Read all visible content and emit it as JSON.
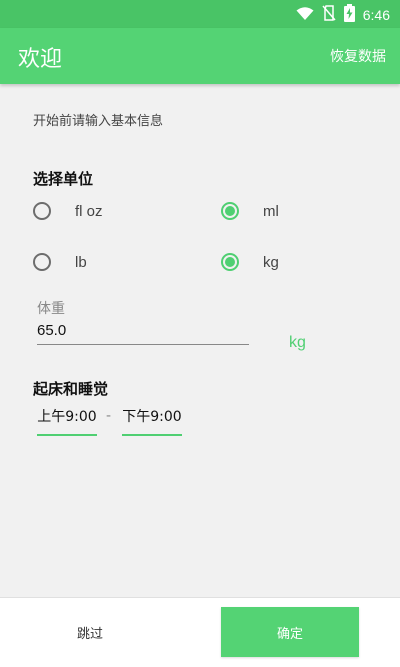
{
  "status_bar": {
    "time": "6:46",
    "icons": [
      "wifi-icon",
      "no-sim-icon",
      "battery-charging-icon"
    ]
  },
  "app_bar": {
    "title": "欢迎",
    "action": "恢复数据"
  },
  "intro": "开始前请输入基本信息",
  "units": {
    "title": "选择单位",
    "options": [
      {
        "label": "fl oz",
        "checked": false
      },
      {
        "label": "ml",
        "checked": true
      },
      {
        "label": "lb",
        "checked": false
      },
      {
        "label": "kg",
        "checked": true
      }
    ]
  },
  "weight": {
    "label": "体重",
    "value": "65.0",
    "unit": "kg"
  },
  "sleep": {
    "title": "起床和睡觉",
    "wake_time": "上午9:00",
    "separator": "-",
    "sleep_time": "下午9:00"
  },
  "footer": {
    "skip": "跳过",
    "confirm": "确定"
  },
  "colors": {
    "primary": "#54d374",
    "status_bar": "#49c466",
    "accent": "#4fcf72"
  }
}
